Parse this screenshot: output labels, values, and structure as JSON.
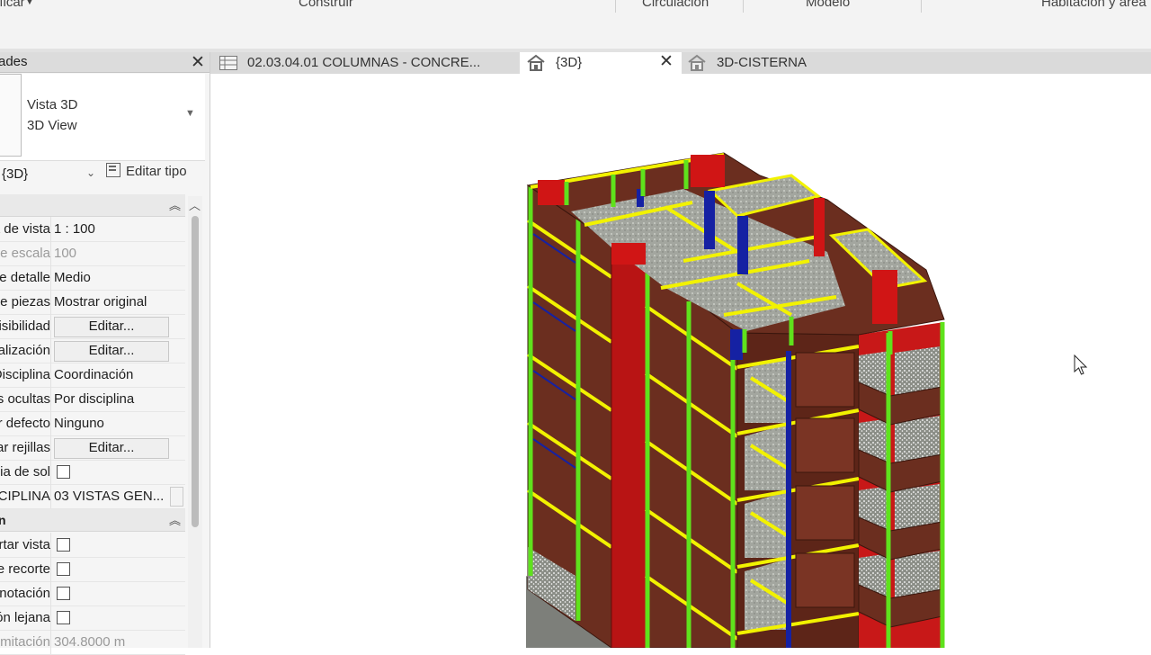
{
  "ribbon": {
    "groups": [
      "ificar",
      "Construir",
      "Circulación",
      "Modelo",
      "Habitación y área"
    ]
  },
  "properties": {
    "title": "ades",
    "type_line1": "Vista 3D",
    "type_line2": "3D View",
    "view_selector": "{3D}",
    "edit_type": "Editar tipo",
    "rows": [
      {
        "k": "Escala de vista",
        "v": "1 : 100"
      },
      {
        "k": "Valor de escala",
        "v": "100"
      },
      {
        "k": "Nivel de detalle",
        "v": "Medio"
      },
      {
        "k": "Visibilidad de piezas",
        "v": "Mostrar original"
      },
      {
        "k": "Modificaciones de visibilidad",
        "v": "Editar..."
      },
      {
        "k": "Opciones de visualización",
        "v": "Editar..."
      },
      {
        "k": "Disciplina",
        "v": "Coordinación"
      },
      {
        "k": "Mostrar líneas ocultas",
        "v": "Por disciplina"
      },
      {
        "k": "Color por defecto",
        "v": "Ninguno"
      },
      {
        "k": "Mostrar rejillas",
        "v": "Editar..."
      },
      {
        "k": "Trayectoria de sol",
        "v": ""
      },
      {
        "k": "SUBDISCIPLINA",
        "v": "03 VISTAS GEN..."
      }
    ],
    "section2_label": "n",
    "rows2": [
      {
        "k": "Recortar vista",
        "v": ""
      },
      {
        "k": "Región de recorte",
        "v": ""
      },
      {
        "k": "Región de anotación",
        "v": ""
      },
      {
        "k": "Delimitación lejana",
        "v": ""
      },
      {
        "k": "Distancia de delimitación",
        "v": "304.8000 m"
      }
    ]
  },
  "tabs": [
    {
      "label": "02.03.04.01 COLUMNAS - CONCRE..."
    },
    {
      "label": "{3D}"
    },
    {
      "label": "3D-CISTERNA"
    }
  ],
  "colors": {
    "wall_brown": "#6b2e1f",
    "slab_grey": "#9a9d96",
    "beam_yellow": "#f2f200",
    "column_green": "#5fe21c",
    "column_blue": "#1521a3",
    "concrete_red": "#d01515"
  }
}
